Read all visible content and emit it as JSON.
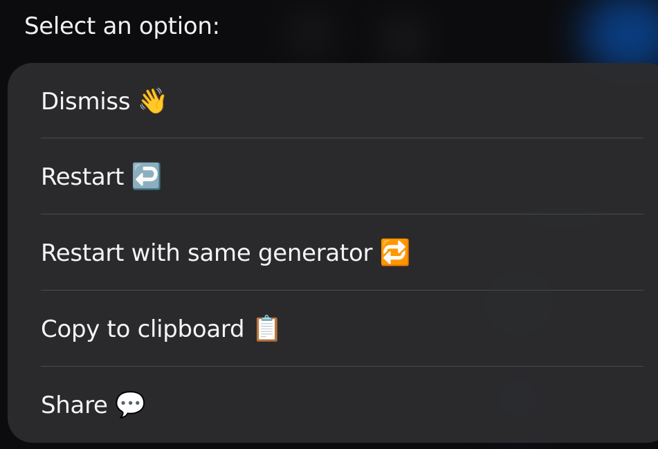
{
  "prompt": {
    "title": "Select an option:"
  },
  "options": [
    {
      "label": "Dismiss",
      "emoji": "👋"
    },
    {
      "label": "Restart",
      "emoji": "↩️"
    },
    {
      "label": "Restart with same generator",
      "emoji": "🔁"
    },
    {
      "label": "Copy to clipboard",
      "emoji": "📋"
    },
    {
      "label": "Share",
      "emoji": "💬"
    }
  ],
  "colors": {
    "sheet_background": "#2c2c2e",
    "text": "#f5f5f7",
    "separator": "#4a4a4e",
    "backdrop": "#0c0c0e"
  }
}
